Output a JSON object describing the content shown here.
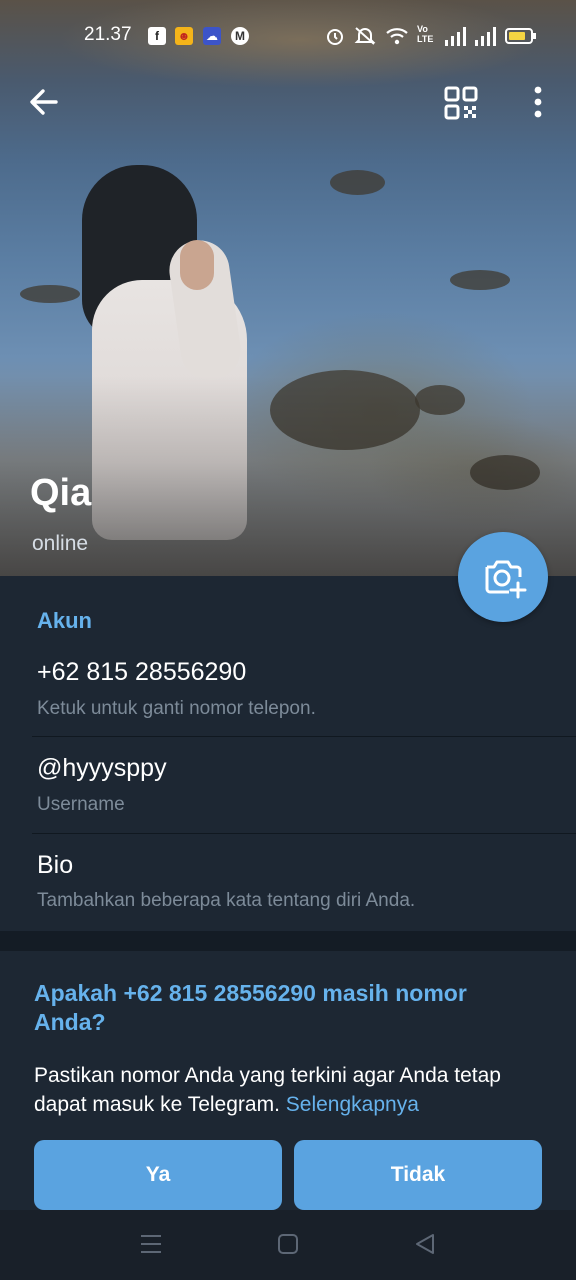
{
  "status_bar": {
    "time": "21.37",
    "app_icons": [
      "facebook-icon",
      "game-app-icon",
      "weather-app-icon",
      "m-app-icon"
    ],
    "right_icons": [
      "alarm-icon",
      "mute-icon",
      "wifi-icon",
      "volte-icon",
      "signal-icon",
      "signal-icon",
      "battery-icon"
    ],
    "volte_label": "Vo LTE"
  },
  "toolbar": {
    "back_icon": "arrow-left-icon",
    "qr_icon": "qr-code-icon",
    "more_icon": "more-vertical-icon"
  },
  "profile": {
    "name": "Qia",
    "status": "online",
    "camera_icon": "camera-add-icon"
  },
  "account": {
    "section_title": "Akun",
    "phone": {
      "value": "+62 815 28556290",
      "hint": "Ketuk untuk ganti nomor telepon."
    },
    "username": {
      "value": "@hyyysppy",
      "hint": "Username"
    },
    "bio": {
      "value": "Bio",
      "hint": "Tambahkan beberapa kata tentang diri Anda."
    }
  },
  "suggestion": {
    "title": "Apakah  +62 815 28556290 masih nomor Anda?",
    "body": "Pastikan nomor Anda yang terkini agar Anda tetap dapat masuk ke Telegram.",
    "link": "Selengkapnya",
    "yes_label": "Ya",
    "no_label": "Tidak"
  },
  "navbar": {
    "items": [
      "menu-icon",
      "home-icon",
      "back-triangle-icon"
    ]
  },
  "colors": {
    "accent": "#5aa3e0",
    "link": "#66b2ec",
    "background": "#1d2733"
  }
}
